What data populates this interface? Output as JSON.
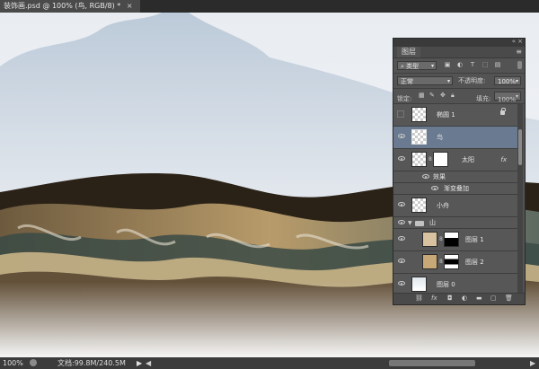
{
  "tab": {
    "title": "装饰画.psd @ 100% (鸟, RGB/8) *",
    "close": "×"
  },
  "status": {
    "zoom": "100%",
    "doc": "文档:99.8M/240.5M",
    "arrow": "▶"
  },
  "panel": {
    "title": "图层",
    "menu": "≡",
    "filter_kind": "类型",
    "blend_mode": "正常",
    "opacity_label": "不透明度:",
    "opacity_value": "100%",
    "lock_label": "锁定:",
    "fill_label": "填充:",
    "fill_value": "100%"
  },
  "layers": [
    {
      "name": "椭圆 1",
      "visible": false,
      "locked": true
    },
    {
      "name": "鸟",
      "visible": true,
      "selected": true
    },
    {
      "name": "太阳",
      "visible": true,
      "fx": "fx"
    },
    {
      "name": "效果"
    },
    {
      "name": "渐变叠加"
    },
    {
      "name": "小舟",
      "visible": true
    },
    {
      "name": "山",
      "visible": true
    },
    {
      "name": "图层 1",
      "visible": true
    },
    {
      "name": "图层 2",
      "visible": true
    },
    {
      "name": "图层 0",
      "visible": true
    }
  ],
  "bottom_icons": [
    "link-icon",
    "fx-icon",
    "mask-icon",
    "adjustment-icon",
    "folder-icon",
    "new-layer-icon",
    "trash-icon"
  ]
}
